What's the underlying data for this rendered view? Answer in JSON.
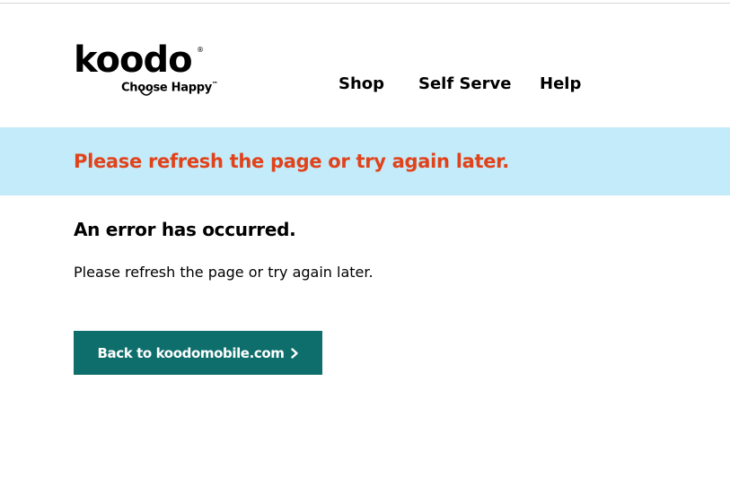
{
  "brand": {
    "logo_text": "koodo",
    "tagline": "Choose Happy",
    "registered_mark": "®",
    "tagline_mark": "™"
  },
  "nav": {
    "items": [
      {
        "label": "Shop"
      },
      {
        "label": "Self Serve"
      },
      {
        "label": "Help"
      }
    ]
  },
  "banner": {
    "message": "Please refresh the page or try again later."
  },
  "error": {
    "heading": "An error has occurred.",
    "body": "Please refresh the page or try again later."
  },
  "actions": {
    "back_label": "Back to koodomobile.com",
    "back_icon": "chevron-right-icon"
  },
  "colors": {
    "banner_bg": "#c3ebf9",
    "banner_text": "#e1421a",
    "button_bg": "#0e6e6b",
    "button_text": "#ffffff"
  }
}
